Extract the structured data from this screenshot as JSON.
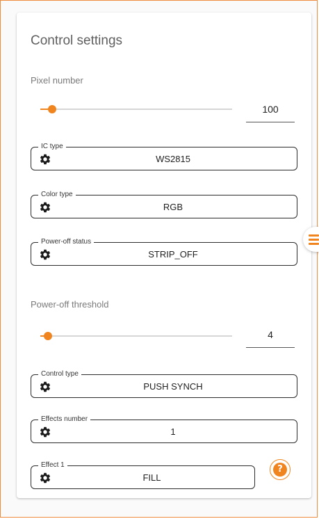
{
  "title": "Control settings",
  "pixel_number": {
    "label": "Pixel number",
    "value": "100",
    "slider_fraction": 0.06
  },
  "ic_type": {
    "legend": "IC type",
    "value": "WS2815",
    "icon": "gear-icon"
  },
  "color_type": {
    "legend": "Color type",
    "value": "RGB",
    "icon": "gear-icon"
  },
  "power_off_status": {
    "legend": "Power-off status",
    "value": "STRIP_OFF",
    "icon": "gear-icon"
  },
  "power_off_threshold": {
    "label": "Power-off threshold",
    "value": "4",
    "slider_fraction": 0.04
  },
  "control_type": {
    "legend": "Control type",
    "value": "PUSH SYNCH",
    "icon": "gear-icon"
  },
  "effects_number": {
    "legend": "Effects number",
    "value": "1",
    "icon": "gear-icon"
  },
  "effect_1": {
    "legend": "Effect 1",
    "value": "FILL",
    "icon": "gear-icon"
  },
  "help": {
    "icon": "help-icon",
    "glyph": "?"
  },
  "side_menu": {
    "icon": "menu-icon"
  },
  "colors": {
    "accent": "#f0851f",
    "frame": "#f08a3c"
  }
}
